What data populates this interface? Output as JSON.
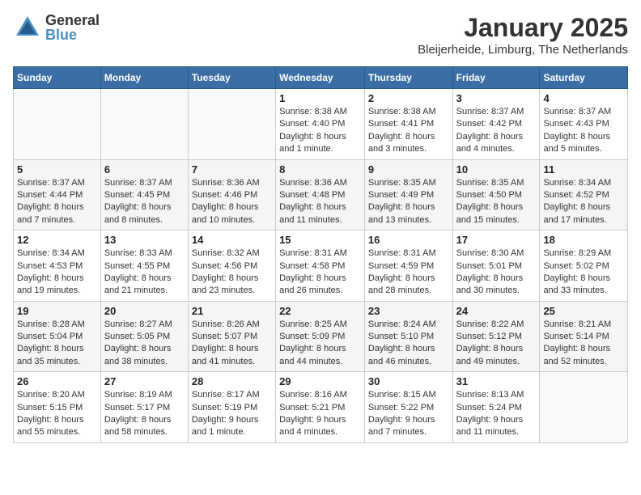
{
  "header": {
    "logo_general": "General",
    "logo_blue": "Blue",
    "month": "January 2025",
    "location": "Bleijerheide, Limburg, The Netherlands"
  },
  "days_of_week": [
    "Sunday",
    "Monday",
    "Tuesday",
    "Wednesday",
    "Thursday",
    "Friday",
    "Saturday"
  ],
  "weeks": [
    [
      {
        "day": "",
        "info": ""
      },
      {
        "day": "",
        "info": ""
      },
      {
        "day": "",
        "info": ""
      },
      {
        "day": "1",
        "info": "Sunrise: 8:38 AM\nSunset: 4:40 PM\nDaylight: 8 hours\nand 1 minute."
      },
      {
        "day": "2",
        "info": "Sunrise: 8:38 AM\nSunset: 4:41 PM\nDaylight: 8 hours\nand 3 minutes."
      },
      {
        "day": "3",
        "info": "Sunrise: 8:37 AM\nSunset: 4:42 PM\nDaylight: 8 hours\nand 4 minutes."
      },
      {
        "day": "4",
        "info": "Sunrise: 8:37 AM\nSunset: 4:43 PM\nDaylight: 8 hours\nand 5 minutes."
      }
    ],
    [
      {
        "day": "5",
        "info": "Sunrise: 8:37 AM\nSunset: 4:44 PM\nDaylight: 8 hours\nand 7 minutes."
      },
      {
        "day": "6",
        "info": "Sunrise: 8:37 AM\nSunset: 4:45 PM\nDaylight: 8 hours\nand 8 minutes."
      },
      {
        "day": "7",
        "info": "Sunrise: 8:36 AM\nSunset: 4:46 PM\nDaylight: 8 hours\nand 10 minutes."
      },
      {
        "day": "8",
        "info": "Sunrise: 8:36 AM\nSunset: 4:48 PM\nDaylight: 8 hours\nand 11 minutes."
      },
      {
        "day": "9",
        "info": "Sunrise: 8:35 AM\nSunset: 4:49 PM\nDaylight: 8 hours\nand 13 minutes."
      },
      {
        "day": "10",
        "info": "Sunrise: 8:35 AM\nSunset: 4:50 PM\nDaylight: 8 hours\nand 15 minutes."
      },
      {
        "day": "11",
        "info": "Sunrise: 8:34 AM\nSunset: 4:52 PM\nDaylight: 8 hours\nand 17 minutes."
      }
    ],
    [
      {
        "day": "12",
        "info": "Sunrise: 8:34 AM\nSunset: 4:53 PM\nDaylight: 8 hours\nand 19 minutes."
      },
      {
        "day": "13",
        "info": "Sunrise: 8:33 AM\nSunset: 4:55 PM\nDaylight: 8 hours\nand 21 minutes."
      },
      {
        "day": "14",
        "info": "Sunrise: 8:32 AM\nSunset: 4:56 PM\nDaylight: 8 hours\nand 23 minutes."
      },
      {
        "day": "15",
        "info": "Sunrise: 8:31 AM\nSunset: 4:58 PM\nDaylight: 8 hours\nand 26 minutes."
      },
      {
        "day": "16",
        "info": "Sunrise: 8:31 AM\nSunset: 4:59 PM\nDaylight: 8 hours\nand 28 minutes."
      },
      {
        "day": "17",
        "info": "Sunrise: 8:30 AM\nSunset: 5:01 PM\nDaylight: 8 hours\nand 30 minutes."
      },
      {
        "day": "18",
        "info": "Sunrise: 8:29 AM\nSunset: 5:02 PM\nDaylight: 8 hours\nand 33 minutes."
      }
    ],
    [
      {
        "day": "19",
        "info": "Sunrise: 8:28 AM\nSunset: 5:04 PM\nDaylight: 8 hours\nand 35 minutes."
      },
      {
        "day": "20",
        "info": "Sunrise: 8:27 AM\nSunset: 5:05 PM\nDaylight: 8 hours\nand 38 minutes."
      },
      {
        "day": "21",
        "info": "Sunrise: 8:26 AM\nSunset: 5:07 PM\nDaylight: 8 hours\nand 41 minutes."
      },
      {
        "day": "22",
        "info": "Sunrise: 8:25 AM\nSunset: 5:09 PM\nDaylight: 8 hours\nand 44 minutes."
      },
      {
        "day": "23",
        "info": "Sunrise: 8:24 AM\nSunset: 5:10 PM\nDaylight: 8 hours\nand 46 minutes."
      },
      {
        "day": "24",
        "info": "Sunrise: 8:22 AM\nSunset: 5:12 PM\nDaylight: 8 hours\nand 49 minutes."
      },
      {
        "day": "25",
        "info": "Sunrise: 8:21 AM\nSunset: 5:14 PM\nDaylight: 8 hours\nand 52 minutes."
      }
    ],
    [
      {
        "day": "26",
        "info": "Sunrise: 8:20 AM\nSunset: 5:15 PM\nDaylight: 8 hours\nand 55 minutes."
      },
      {
        "day": "27",
        "info": "Sunrise: 8:19 AM\nSunset: 5:17 PM\nDaylight: 8 hours\nand 58 minutes."
      },
      {
        "day": "28",
        "info": "Sunrise: 8:17 AM\nSunset: 5:19 PM\nDaylight: 9 hours\nand 1 minute."
      },
      {
        "day": "29",
        "info": "Sunrise: 8:16 AM\nSunset: 5:21 PM\nDaylight: 9 hours\nand 4 minutes."
      },
      {
        "day": "30",
        "info": "Sunrise: 8:15 AM\nSunset: 5:22 PM\nDaylight: 9 hours\nand 7 minutes."
      },
      {
        "day": "31",
        "info": "Sunrise: 8:13 AM\nSunset: 5:24 PM\nDaylight: 9 hours\nand 11 minutes."
      },
      {
        "day": "",
        "info": ""
      }
    ]
  ]
}
